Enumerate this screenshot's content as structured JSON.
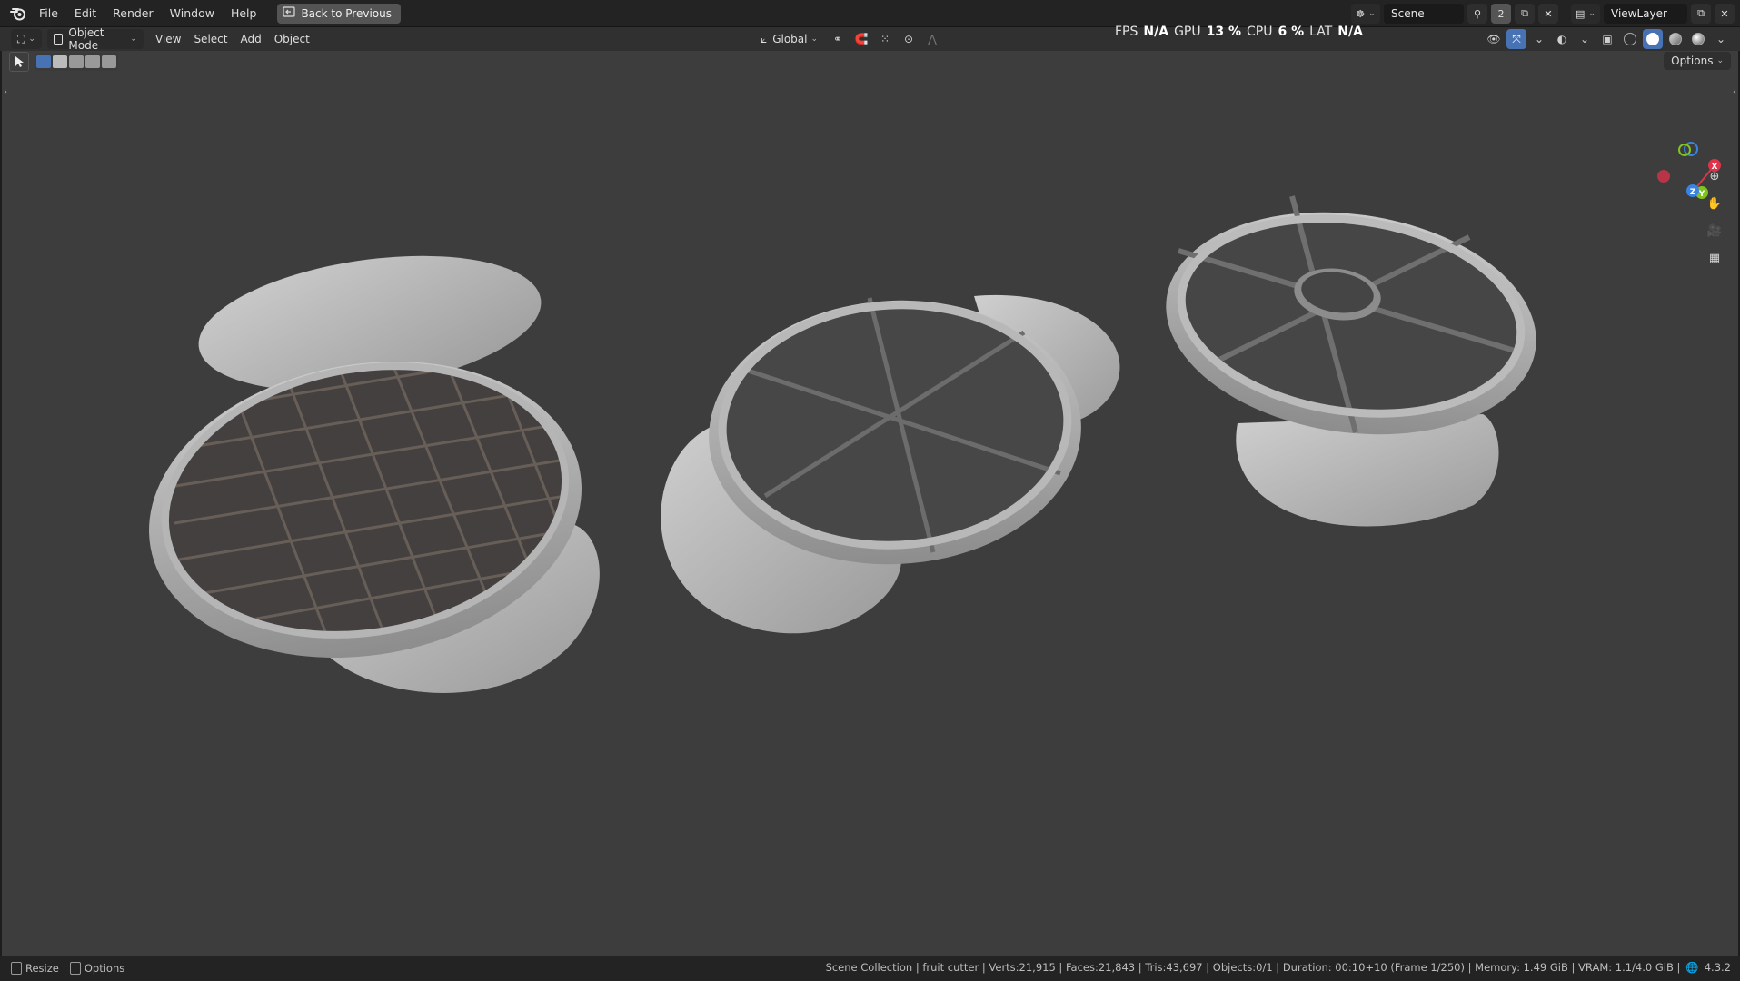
{
  "menu": {
    "items": [
      "File",
      "Edit",
      "Render",
      "Window",
      "Help"
    ],
    "back_button": "Back to Previous"
  },
  "topright": {
    "scene_name": "Scene",
    "scene_count": "2",
    "view_layer": "ViewLayer"
  },
  "header": {
    "mode": "Object Mode",
    "menus": [
      "View",
      "Select",
      "Add",
      "Object"
    ],
    "orientation": "Global",
    "options": "Options"
  },
  "perf": {
    "fps_label": "FPS",
    "fps_value": "N/A",
    "gpu_label": "GPU",
    "gpu_value": "13 %",
    "cpu_label": "CPU",
    "cpu_value": "6 %",
    "lat_label": "LAT",
    "lat_value": "N/A"
  },
  "gizmo": {
    "x": "X",
    "y": "Y",
    "z": "Z"
  },
  "status": {
    "resize": "Resize",
    "options": "Options",
    "info": "Scene Collection | fruit cutter | Verts:21,915 | Faces:21,843 | Tris:43,697 | Objects:0/1 | Duration: 00:10+10 (Frame 1/250) | Memory: 1.49 GiB | VRAM: 1.1/4.0 GiB |",
    "version": "4.3.2"
  },
  "colors": {
    "accent": "#4772b3",
    "viewport_bg": "#3d3d3d",
    "axis_x": "#e0334a",
    "axis_y": "#7fc31c",
    "axis_z": "#3b83e0"
  }
}
